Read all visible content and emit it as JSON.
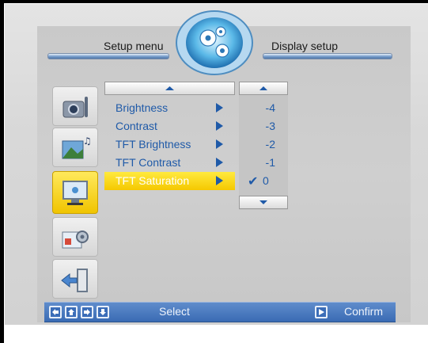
{
  "header": {
    "left_label": "Setup menu",
    "right_label": "Display setup"
  },
  "side_menu": [
    {
      "icon": "camera-settings-icon",
      "active": false
    },
    {
      "icon": "image-music-icon",
      "active": false
    },
    {
      "icon": "display-icon",
      "active": true
    },
    {
      "icon": "tools-icon",
      "active": false
    },
    {
      "icon": "exit-door-icon",
      "active": false
    }
  ],
  "menu": {
    "items": [
      {
        "label": "Brightness"
      },
      {
        "label": "Contrast"
      },
      {
        "label": "TFT Brightness"
      },
      {
        "label": "TFT Contrast"
      },
      {
        "label": "TFT Saturation",
        "selected": true
      }
    ]
  },
  "values": {
    "items": [
      "-4",
      "-3",
      "-2",
      "-1",
      "0"
    ],
    "checked_value": "0"
  },
  "footer": {
    "select_label": "Select",
    "confirm_label": "Confirm"
  },
  "colors": {
    "accent_yellow": "#f5c800",
    "text_blue": "#1f5aa8",
    "bar_blue": "#3a6bb4"
  }
}
